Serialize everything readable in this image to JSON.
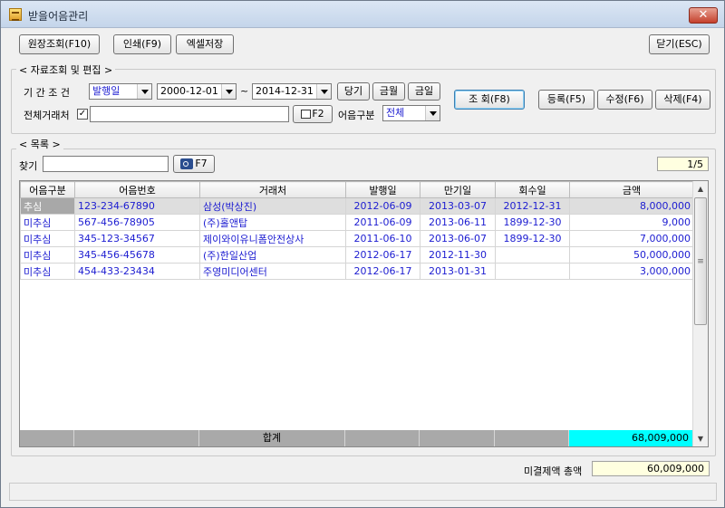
{
  "window": {
    "title": "받을어음관리",
    "close_label": "✕"
  },
  "toolbar": {
    "ledger_label": "원장조회(F10)",
    "print_label": "인쇄(F9)",
    "excel_label": "엑셀저장",
    "close_label": "닫기(ESC)"
  },
  "query": {
    "group_title": "< 자료조회 및 편집 >",
    "period_label": "기 간 조 건",
    "period_type": "발행일",
    "date_from": "2000-12-01",
    "tilde": "~",
    "date_to": "2014-12-31",
    "prev_label": "당기",
    "month_label": "금월",
    "today_label": "금일",
    "search_label": "조 회(F8)",
    "register_label": "등록(F5)",
    "edit_label": "수정(F6)",
    "delete_label": "삭제(F4)",
    "all_vendor_label": "전체거래처",
    "all_vendor_checked": "✓",
    "vendor_value": "",
    "f2_label": "F2",
    "note_type_label": "어음구분",
    "note_type_value": "전체"
  },
  "list": {
    "group_title": "< 목록 >",
    "find_label": "찾기",
    "find_value": "",
    "f7_label": "F7",
    "page": "1/5",
    "columns": [
      "어음구분",
      "어음번호",
      "거래처",
      "발행일",
      "만기일",
      "회수일",
      "금액"
    ],
    "rows": [
      {
        "type": "추심",
        "number": "123-234-67890",
        "vendor": "삼성(박상진)",
        "issue": "2012-06-09",
        "due": "2013-03-07",
        "collected": "2012-12-31",
        "amount": "8,000,000"
      },
      {
        "type": "미추심",
        "number": "567-456-78905",
        "vendor": "(주)홀앤탑",
        "issue": "2011-06-09",
        "due": "2013-06-11",
        "collected": "1899-12-30",
        "amount": "9,000"
      },
      {
        "type": "미추심",
        "number": "345-123-34567",
        "vendor": "제이와이유니폼안전상사",
        "issue": "2011-06-10",
        "due": "2013-06-07",
        "collected": "1899-12-30",
        "amount": "7,000,000"
      },
      {
        "type": "미추심",
        "number": "345-456-45678",
        "vendor": "(주)한일산업",
        "issue": "2012-06-17",
        "due": "2012-11-30",
        "collected": "",
        "amount": "50,000,000"
      },
      {
        "type": "미추심",
        "number": "454-433-23434",
        "vendor": "주영미디어센터",
        "issue": "2012-06-17",
        "due": "2013-01-31",
        "collected": "",
        "amount": "3,000,000"
      }
    ],
    "sum_label": "합계",
    "sum_amount": "68,009,000"
  },
  "footer": {
    "unsettled_label": "미결제액 총액",
    "unsettled_value": "60,009,000"
  },
  "colors": {
    "total_cell": "#00ffff",
    "row_text": "#1c1cd1"
  }
}
